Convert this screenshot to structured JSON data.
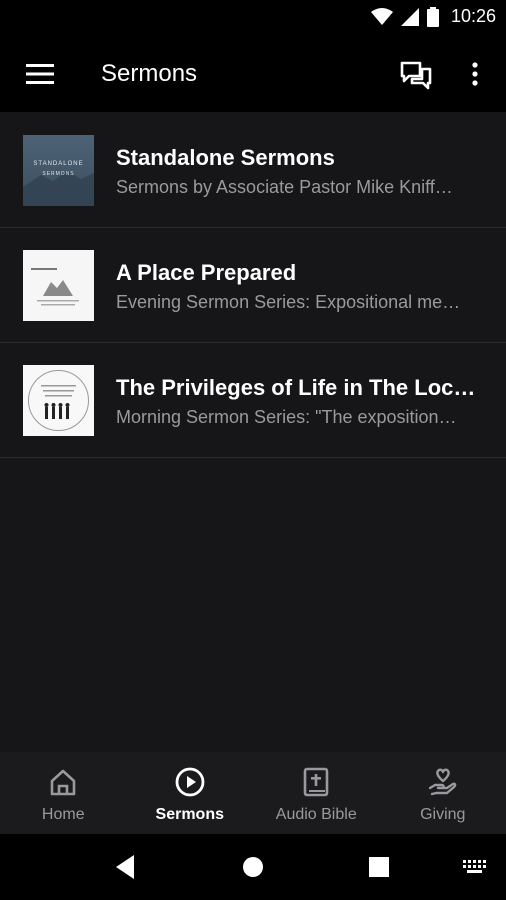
{
  "status": {
    "time": "10:26"
  },
  "appbar": {
    "title": "Sermons"
  },
  "sermons": [
    {
      "title": "Standalone Sermons",
      "subtitle": "Sermons by Associate Pastor Mike Kniff…",
      "thumb_text": [
        "STANDALONE",
        "SERMONS"
      ]
    },
    {
      "title": "A Place Prepared",
      "subtitle": "Evening Sermon Series: Expositional me…"
    },
    {
      "title": "The Privileges of Life in The Loc…",
      "subtitle": "Morning Sermon Series: \"The exposition…"
    }
  ],
  "nav": [
    {
      "label": "Home",
      "icon": "home-icon",
      "active": false
    },
    {
      "label": "Sermons",
      "icon": "play-circle-icon",
      "active": true
    },
    {
      "label": "Audio Bible",
      "icon": "bible-icon",
      "active": false
    },
    {
      "label": "Giving",
      "icon": "giving-hand-icon",
      "active": false
    }
  ],
  "colors": {
    "background": "#161618",
    "appbar": "#000000",
    "subtitle": "#9a9a9e",
    "nav_active": "#ffffff"
  }
}
